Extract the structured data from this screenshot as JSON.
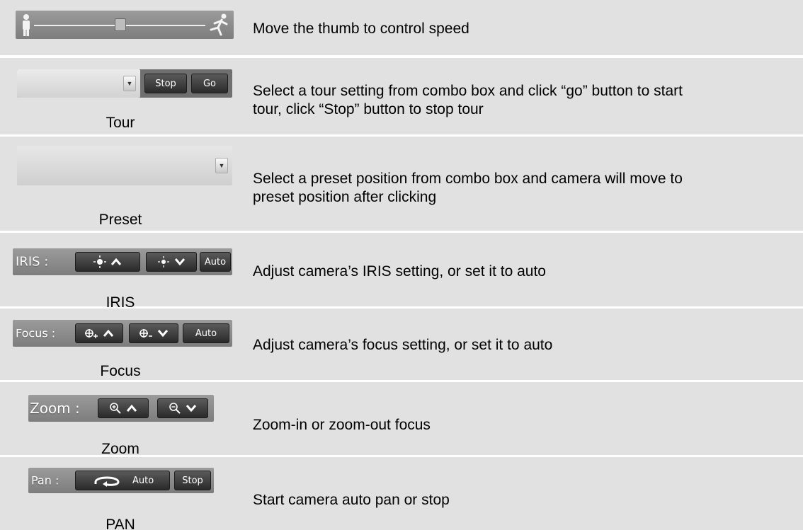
{
  "rows": {
    "speed": {
      "desc": "Move the thumb to control speed"
    },
    "tour": {
      "desc_line1": "Select a tour setting from combo box and click “go” button to start",
      "desc_line2": "tour, click “Stop” button to stop tour",
      "caption": "Tour",
      "stop_label": "Stop",
      "go_label": "Go"
    },
    "preset": {
      "desc_line1": "Select a preset position from combo box and camera will move to",
      "desc_line2": "preset position after clicking",
      "caption": "Preset"
    },
    "iris": {
      "desc": "Adjust camera’s IRIS setting, or set it to auto",
      "caption": "IRIS",
      "strip_label": "IRIS :",
      "auto_label": "Auto"
    },
    "focus": {
      "desc": "Adjust camera’s focus setting, or set it to auto",
      "caption": "Focus",
      "strip_label": "Focus :",
      "auto_label": "Auto"
    },
    "zoom": {
      "desc": "Zoom-in or zoom-out focus",
      "caption": "Zoom",
      "strip_label": "Zoom :"
    },
    "pan": {
      "desc": "Start camera auto pan or stop",
      "caption": "PAN",
      "strip_label": "Pan :",
      "auto_label": "Auto",
      "stop_label": "Stop"
    }
  },
  "colors": {
    "row_bg": "#e1e1e1",
    "strip": "#8a8a8a",
    "button": "#333333"
  },
  "icons": [
    "standing-person-icon",
    "speed-thumb-icon",
    "running-person-icon",
    "dropdown-arrow-icon",
    "sun-icon",
    "chevron-up-icon",
    "chevron-down-icon",
    "focus-plus-icon",
    "focus-minus-icon",
    "zoom-in-icon",
    "zoom-out-icon",
    "pan-loop-icon"
  ]
}
